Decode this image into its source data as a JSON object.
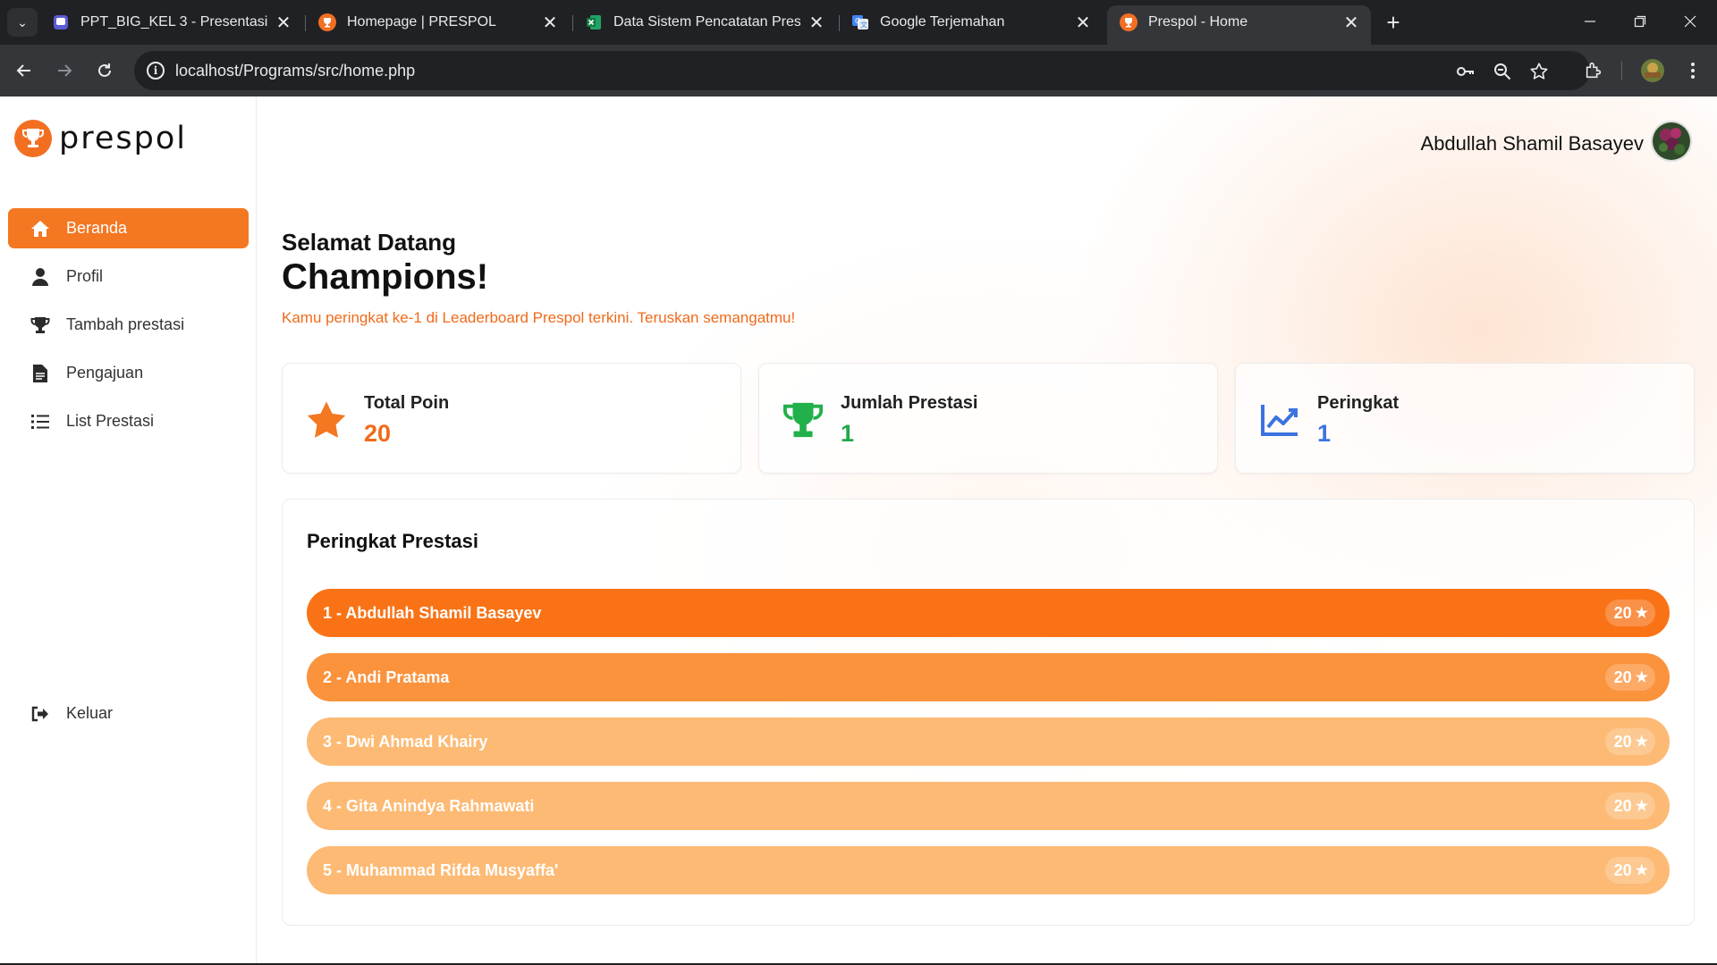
{
  "browser": {
    "tabs": [
      {
        "title": "PPT_BIG_KEL 3 - Presentasi",
        "icon": "presentation-app-icon"
      },
      {
        "title": "Homepage | PRESPOL",
        "icon": "prespol-favicon"
      },
      {
        "title": "Data Sistem Pencatatan Prestasi",
        "icon": "excel-icon"
      },
      {
        "title": "Google Terjemahan",
        "icon": "google-translate-icon"
      },
      {
        "title": "Prespol - Home",
        "icon": "prespol-favicon",
        "active": true
      }
    ],
    "url": "localhost/Programs/src/home.php"
  },
  "sidebar": {
    "logo_text": "prespol",
    "menu": [
      {
        "label": "Beranda",
        "icon": "home-icon",
        "active": true
      },
      {
        "label": "Profil",
        "icon": "user-icon"
      },
      {
        "label": "Tambah prestasi",
        "icon": "trophy-icon"
      },
      {
        "label": "Pengajuan",
        "icon": "document-icon"
      },
      {
        "label": "List Prestasi",
        "icon": "list-icon"
      }
    ],
    "logout_label": "Keluar"
  },
  "header": {
    "user_name": "Abdullah Shamil Basayev"
  },
  "welcome": {
    "line1": "Selamat Datang",
    "line2": "Champions!",
    "subtitle": "Kamu peringkat ke-1 di Leaderboard Prespol terkini. Teruskan semangatmu!"
  },
  "stats": [
    {
      "label": "Total Poin",
      "value": "20",
      "icon": "star-icon",
      "color": "#f06a1a"
    },
    {
      "label": "Jumlah Prestasi",
      "value": "1",
      "icon": "trophy-icon",
      "color": "#22a84a"
    },
    {
      "label": "Peringkat",
      "value": "1",
      "icon": "chart-line-icon",
      "color": "#3b73e0"
    }
  ],
  "leaderboard": {
    "title": "Peringkat Prestasi",
    "rows": [
      {
        "label": "1 - Abdullah Shamil Basayev",
        "points": "20",
        "color": "#f97316"
      },
      {
        "label": "2 - Andi Pratama",
        "points": "20",
        "color": "#fb923c"
      },
      {
        "label": "3 - Dwi Ahmad Khairy",
        "points": "20",
        "color": "#fdba74"
      },
      {
        "label": "4 - Gita Anindya Rahmawati",
        "points": "20",
        "color": "#fdba74"
      },
      {
        "label": "5 - Muhammad Rifda Musyaffa'",
        "points": "20",
        "color": "#fdba74"
      }
    ]
  }
}
